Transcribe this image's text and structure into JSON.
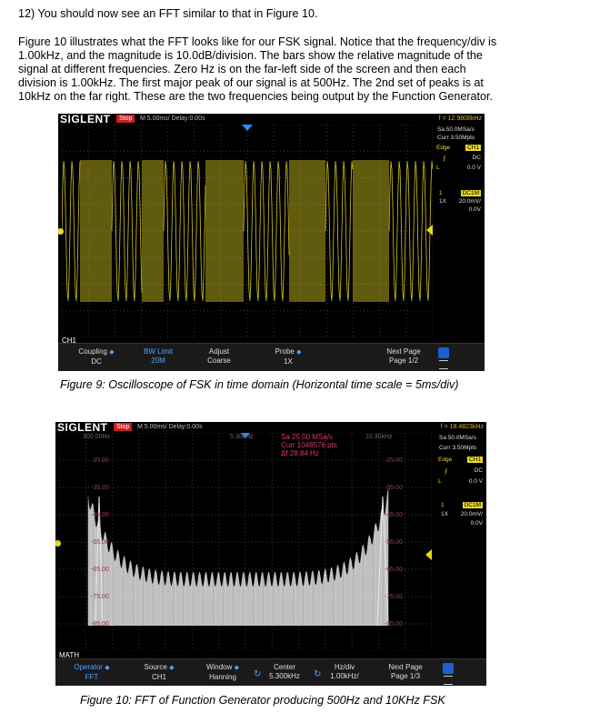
{
  "step": "12) You should now see an FFT similar to that in Figure 10.",
  "paragraph_lines": [
    "Figure 10 illustrates what the FFT looks like for our FSK signal. Notice that the frequency/div is",
    "1.00kHz, and the magnitude is 10.0dB/division. The bars show the relative magnitude of the",
    "signal at different frequencies. Zero Hz is on the far-left side of the screen and then each",
    "division is 1.00kHz. The first major peak of our signal is at 500Hz. The 2nd set of peaks is at",
    "10kHz on the far right. These are the two frequencies being output by the Function Generator."
  ],
  "fig9": {
    "logo": "SIGLENT",
    "stop": "Stop",
    "timebase": "M 5.00ms/ Delay:0.00s",
    "freq": "f = 12.9808kHz",
    "sa": "Sa 50.0MSa/s",
    "curr": "Curr 3.50Mpts",
    "edge": "Edge",
    "ch": "CH1",
    "dc": "DC",
    "level": "0.0 V",
    "chan_num": "1",
    "coupling_badge": "DC1M",
    "probe": "1X",
    "scale": "20.0mV/",
    "offset": "0.0V",
    "channel_label": "CH1",
    "menu": [
      {
        "label": "Coupling",
        "value": "DC"
      },
      {
        "label": "BW Limit",
        "value": "20M"
      },
      {
        "label": "Adjust",
        "value": "Coarse"
      },
      {
        "label": "Probe",
        "value": "1X"
      },
      {
        "label": "Next Page",
        "value": "Page 1/2"
      }
    ],
    "caption": "Figure 9: Oscilloscope of FSK in time domain (Horizontal time scale = 5ms/div)"
  },
  "fig10": {
    "logo": "SIGLENT",
    "stop": "Stop",
    "timebase": "M 5.00ms/ Delay:0.00s",
    "freq": "f = 18.4823kHz",
    "top_left_freq": "300.00Hz",
    "top_center_freq": "5.30kHz",
    "top_right_freq": "10.30kHz",
    "sa_fft": "Sa 25.00 MSa/s",
    "curr_fft": "Curr 1048576 pts",
    "df": "Δf 28.84 Hz",
    "db_left": [
      "-25.00",
      "-35.00",
      "-45.00",
      "-55.00",
      "-65.00",
      "-75.00",
      "-85.00"
    ],
    "db_right": [
      "-25.00",
      "-35.00",
      "-45.00",
      "-55.00",
      "-65.00",
      "-75.00",
      "-85.00"
    ],
    "sa": "Sa 50.0MSa/s",
    "curr": "Curr 3.50Mpts",
    "edge": "Edge",
    "ch": "CH1",
    "dc": "DC",
    "level": "0.0 V",
    "chan_num": "1",
    "coupling_badge": "DC1M",
    "probe": "1X",
    "scale": "20.0mV/",
    "offset": "0.0V",
    "channel_label": "MATH",
    "menu": [
      {
        "label": "Operator",
        "value": "FFT"
      },
      {
        "label": "Source",
        "value": "CH1"
      },
      {
        "label": "Window",
        "value": "Hanning"
      },
      {
        "label": "Center",
        "value": "5.300kHz"
      },
      {
        "label": "Hz/div",
        "value": "1.00kHz/"
      },
      {
        "label": "Next Page",
        "value": "Page 1/3"
      }
    ],
    "caption": "Figure 10: FFT of Function Generator producing 500Hz and 10KHz FSK"
  },
  "colors": {
    "trace_yellow": "#e8d820",
    "fft_white": "#e8e8e8",
    "accent_blue": "#4fa3ff",
    "stop_red": "#c81e1e"
  }
}
